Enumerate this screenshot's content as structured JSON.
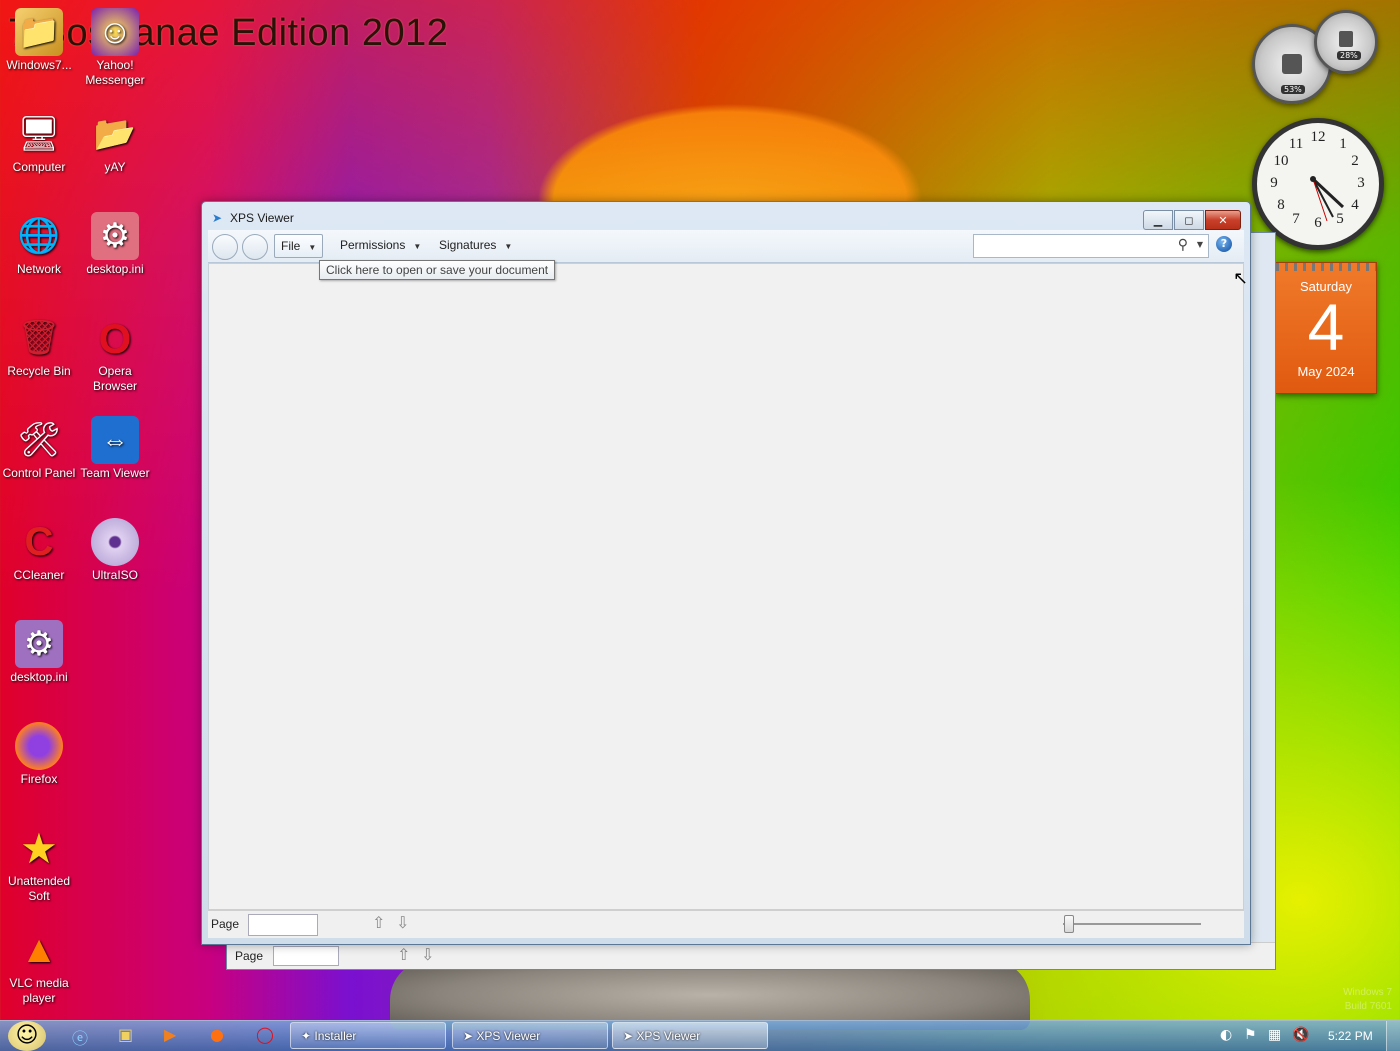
{
  "wallpaper": {
    "title": "7 BosKanae Edition 2012",
    "brand_line1": "Windows 7",
    "brand_line2": "Build 7601"
  },
  "desktop_icons": [
    {
      "label": "Windows7...",
      "icon": "folder-icon"
    },
    {
      "label": "Yahoo! Messenger",
      "icon": "yahoo-messenger-icon"
    },
    {
      "label": "Computer",
      "icon": "computer-icon"
    },
    {
      "label": "yAY",
      "icon": "folder-icon"
    },
    {
      "label": "Network",
      "icon": "network-icon"
    },
    {
      "label": "desktop.ini",
      "icon": "settings-file-icon"
    },
    {
      "label": "Recycle Bin",
      "icon": "recycle-bin-icon"
    },
    {
      "label": "Opera Browser",
      "icon": "opera-icon"
    },
    {
      "label": "Control Panel",
      "icon": "control-panel-icon"
    },
    {
      "label": "Team Viewer",
      "icon": "teamviewer-icon"
    },
    {
      "label": "CCleaner",
      "icon": "ccleaner-icon"
    },
    {
      "label": "UltraISO",
      "icon": "disc-icon"
    },
    {
      "label": "desktop.ini",
      "icon": "settings-file-icon"
    },
    {
      "label": "Firefox",
      "icon": "firefox-icon"
    },
    {
      "label": "Unattended Soft",
      "icon": "star-icon"
    },
    {
      "label": "VLC media player",
      "icon": "vlc-cone-icon"
    }
  ],
  "gadgets": {
    "cpu_percent": "53%",
    "memory_percent": "28%",
    "calendar": {
      "day_name": "Saturday",
      "day": "4",
      "month_year": "May 2024"
    },
    "clock_numbers": [
      "12",
      "1",
      "2",
      "3",
      "4",
      "5",
      "6",
      "7",
      "8",
      "9",
      "10",
      "11"
    ]
  },
  "window": {
    "title": "XPS Viewer",
    "menus": [
      {
        "label": "File",
        "active": true
      },
      {
        "label": "Permissions",
        "active": false
      },
      {
        "label": "Signatures",
        "active": false
      }
    ],
    "search_placeholder": "",
    "tooltip": "Click here to open or save your document",
    "status": {
      "page_label": "Page",
      "page_value": ""
    }
  },
  "back_window": {
    "status": {
      "page_label": "Page"
    }
  },
  "taskbar": {
    "buttons": [
      {
        "label": "Installer"
      },
      {
        "label": "XPS Viewer"
      },
      {
        "label": "XPS Viewer"
      }
    ],
    "time": "5:22 PM"
  }
}
